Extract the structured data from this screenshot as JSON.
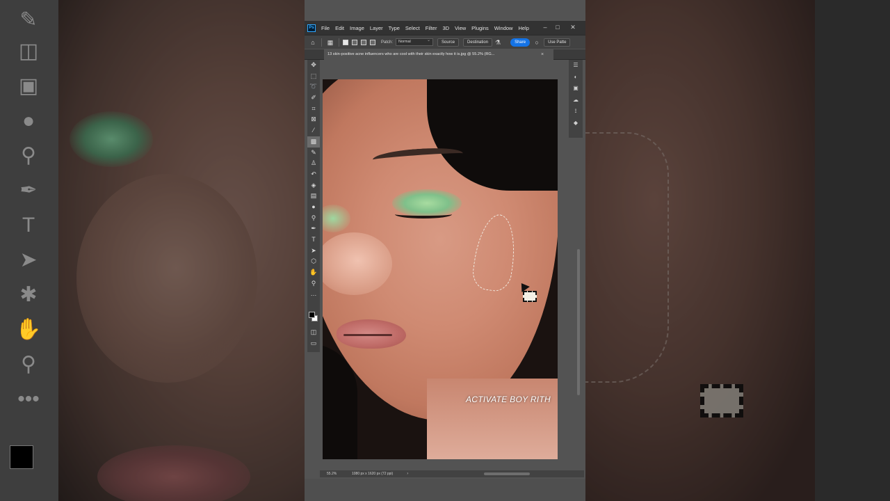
{
  "app": {
    "logo": "Ps",
    "menu": [
      "File",
      "Edit",
      "Image",
      "Layer",
      "Type",
      "Select",
      "Filter",
      "3D",
      "View",
      "Plugins",
      "Window",
      "Help"
    ],
    "window_controls": [
      "–",
      "□",
      "✕"
    ]
  },
  "options": {
    "patch_label": "Patch:",
    "patch_mode": "Normal",
    "source_label": "Source",
    "destination_label": "Destination",
    "share_label": "Share",
    "use_pattern_label": "Use Patte"
  },
  "document": {
    "tab_title": "13 skin-positive acne influencers who are cool with their skin exactly how it is.jpg @ 55.2% (RG...",
    "tab_close": "×"
  },
  "canvas": {
    "watermark": "ACTIVATE BOY RITH"
  },
  "status": {
    "zoom": "55.2%",
    "dimensions": "1080 px x 1620 px (72 ppi)",
    "arrow": "›"
  },
  "icons": {
    "tools": [
      "move-icon",
      "marquee-icon",
      "lasso-icon",
      "quick-select-icon",
      "crop-icon",
      "frame-icon",
      "eyedropper-icon",
      "patch-tool-icon",
      "brush-icon",
      "clone-stamp-icon",
      "history-brush-icon",
      "eraser-icon",
      "gradient-icon",
      "blur-icon",
      "dodge-icon",
      "pen-icon",
      "type-icon",
      "path-select-icon",
      "shape-icon",
      "hand-icon",
      "zoom-icon",
      "more-tools-icon"
    ],
    "right_panel": [
      "adjustments-icon",
      "color-icon",
      "properties-icon",
      "libraries-icon",
      "paths-icon",
      "layers-icon"
    ]
  },
  "colors": {
    "share_button": "#1473e6",
    "ps_logo": "#31a8ff"
  }
}
